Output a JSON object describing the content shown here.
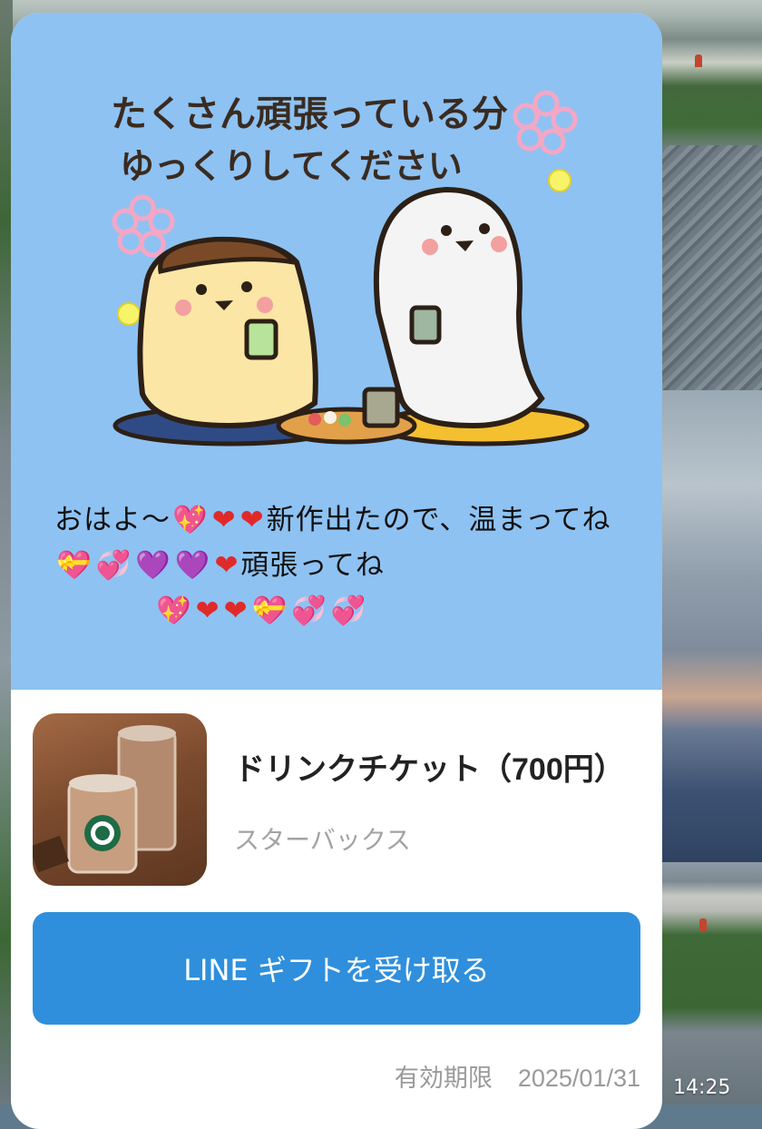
{
  "sticker": {
    "caption_line1": "たくさん頑張っている分",
    "caption_line2": "ゆっくりしてください"
  },
  "message": {
    "text_1": "おはよ〜",
    "text_2": "新作出たので、温まってね",
    "text_3": "頑張ってね"
  },
  "gift": {
    "title": "ドリンクチケット（700円）",
    "brand": "スターバックス",
    "button_label": "LINE ギフトを受け取る",
    "expiry_label": "有効期限",
    "expiry_date": "2025/01/31"
  },
  "timestamp": "14:25",
  "colors": {
    "card_top": "#8ec2f2",
    "button": "#2f8fdc"
  }
}
